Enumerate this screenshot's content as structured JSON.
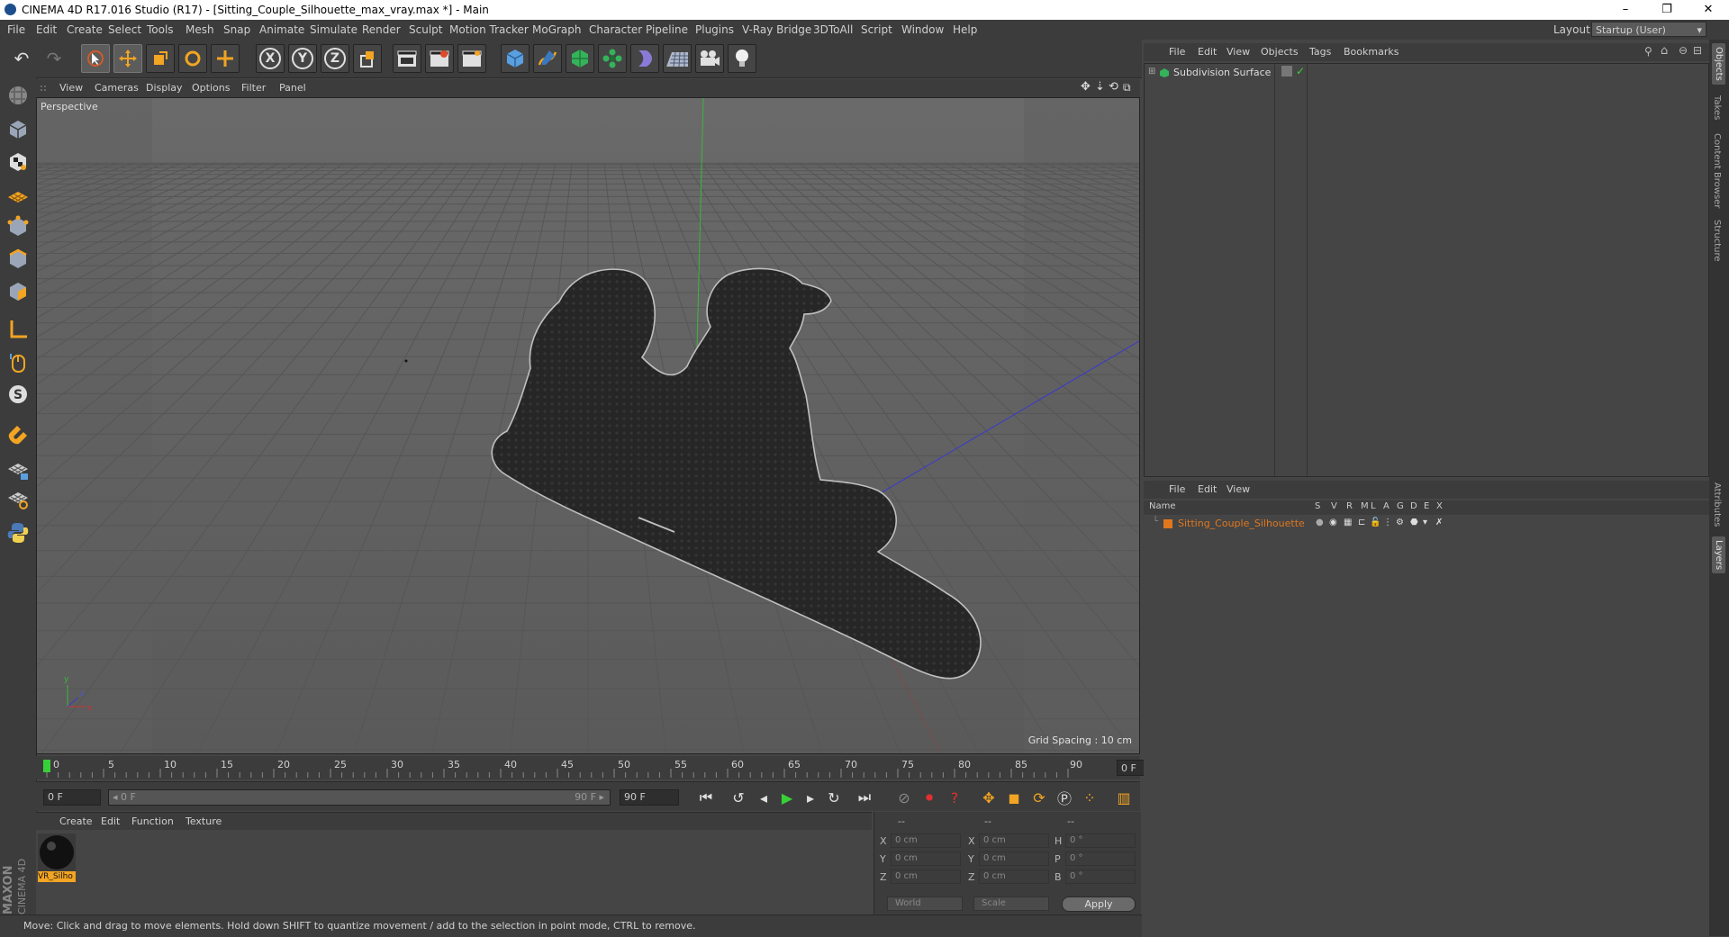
{
  "window": {
    "title": "CINEMA 4D R17.016 Studio (R17) - [Sitting_Couple_Silhouette_max_vray.max *] - Main",
    "controls": [
      "–",
      "❐",
      "✕"
    ]
  },
  "menubar": {
    "items": [
      "File",
      "Edit",
      "Create",
      "Select",
      "Tools",
      "Mesh",
      "Snap",
      "Animate",
      "Simulate",
      "Render",
      "Sculpt",
      "Motion Tracker",
      "MoGraph",
      "Character",
      "Pipeline",
      "Plugins",
      "V-Ray Bridge",
      "3DToAll",
      "Script",
      "Window",
      "Help"
    ],
    "layout_label": "Layout:",
    "layout_value": "Startup (User)"
  },
  "toolbar": {
    "axis_x": "X",
    "axis_y": "Y",
    "axis_z": "Z"
  },
  "viewport": {
    "menu": [
      "View",
      "Cameras",
      "Display",
      "Options",
      "Filter",
      "Panel"
    ],
    "label": "Perspective",
    "grid_spacing": "Grid Spacing : 10 cm"
  },
  "timeline": {
    "ticks": [
      "0",
      "5",
      "10",
      "15",
      "20",
      "25",
      "30",
      "35",
      "40",
      "45",
      "50",
      "55",
      "60",
      "65",
      "70",
      "75",
      "80",
      "85",
      "90"
    ],
    "current_frame": "0 F"
  },
  "transport": {
    "start_field": "0 F",
    "range_start": "◂ 0 F",
    "range_end": "90 F ▸",
    "end_field": "90 F"
  },
  "material_manager": {
    "menu": [
      "Create",
      "Edit",
      "Function",
      "Texture"
    ],
    "material_name": "VR_Silho"
  },
  "coordinates": {
    "headers": [
      "--",
      "--",
      "--"
    ],
    "rows": [
      {
        "a": "X",
        "av": "0 cm",
        "b": "X",
        "bv": "0 cm",
        "c": "H",
        "cv": "0 °"
      },
      {
        "a": "Y",
        "av": "0 cm",
        "b": "Y",
        "bv": "0 cm",
        "c": "P",
        "cv": "0 °"
      },
      {
        "a": "Z",
        "av": "0 cm",
        "b": "Z",
        "bv": "0 cm",
        "c": "B",
        "cv": "0 °"
      }
    ],
    "mode_world": "World",
    "mode_scale": "Scale",
    "apply_label": "Apply"
  },
  "status": {
    "text": "Move: Click and drag to move elements. Hold down SHIFT to quantize movement / add to the selection in point mode, CTRL to remove."
  },
  "object_manager": {
    "menu": [
      "File",
      "Edit",
      "View",
      "Objects",
      "Tags",
      "Bookmarks"
    ],
    "object_name": "Subdivision Surface"
  },
  "layer_manager": {
    "menu": [
      "File",
      "Edit",
      "View"
    ],
    "header_name": "Name",
    "columns": [
      "S",
      "V",
      "R",
      "M",
      "L",
      "A",
      "G",
      "D",
      "E",
      "X"
    ],
    "layer_name": "Sitting_Couple_Silhouette",
    "layer_color": "#e0771d"
  },
  "side_tabs": [
    "Objects",
    "Takes",
    "Content Browser",
    "Structure",
    "Attributes",
    "Layers"
  ],
  "branding": {
    "maxon": "MAXON",
    "cinema": "CINEMA 4D"
  }
}
